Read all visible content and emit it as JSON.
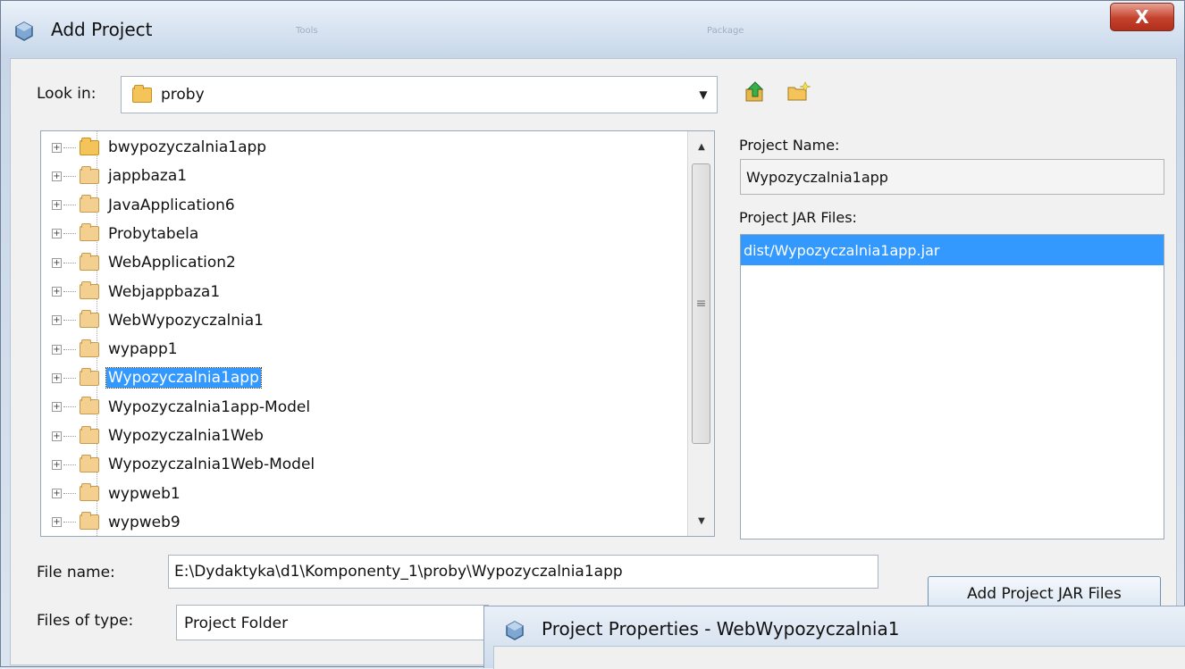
{
  "window": {
    "title": "Add Project",
    "close_label": "X",
    "ghost_tabs": [
      "Tools",
      "Package"
    ]
  },
  "look_in": {
    "label": "Look in:",
    "value": "proby"
  },
  "toolbar": {
    "icons": [
      "up-one-level-icon",
      "create-new-folder-icon"
    ]
  },
  "tree": {
    "items": [
      {
        "label": "bwypozyczalnia1app",
        "folder": "yellow"
      },
      {
        "label": "jappbaza1",
        "folder": "project"
      },
      {
        "label": "JavaApplication6",
        "folder": "project"
      },
      {
        "label": "Probytabela",
        "folder": "project"
      },
      {
        "label": "WebApplication2",
        "folder": "project"
      },
      {
        "label": "Webjappbaza1",
        "folder": "project"
      },
      {
        "label": "WebWypozyczalnia1",
        "folder": "project"
      },
      {
        "label": "wypapp1",
        "folder": "project"
      },
      {
        "label": "Wypozyczalnia1app",
        "folder": "project",
        "selected": true
      },
      {
        "label": "Wypozyczalnia1app-Model",
        "folder": "project"
      },
      {
        "label": "Wypozyczalnia1Web",
        "folder": "project"
      },
      {
        "label": "Wypozyczalnia1Web-Model",
        "folder": "project"
      },
      {
        "label": "wypweb1",
        "folder": "project"
      },
      {
        "label": "wypweb9",
        "folder": "project"
      }
    ]
  },
  "project_name": {
    "label": "Project Name:",
    "value": "Wypozyczalnia1app"
  },
  "project_jar_files": {
    "label": "Project JAR Files:",
    "items": [
      "dist/Wypozyczalnia1app.jar"
    ]
  },
  "file_name": {
    "label": "File name:",
    "value": "E:\\Dydaktyka\\d1\\Komponenty_1\\proby\\Wypozyczalnia1app"
  },
  "files_of_type": {
    "label": "Files of type:",
    "value": "Project Folder"
  },
  "add_jar_button": {
    "label": "Add Project JAR Files"
  },
  "background_window": {
    "title": "Project Properties - WebWypozyczalnia1"
  }
}
